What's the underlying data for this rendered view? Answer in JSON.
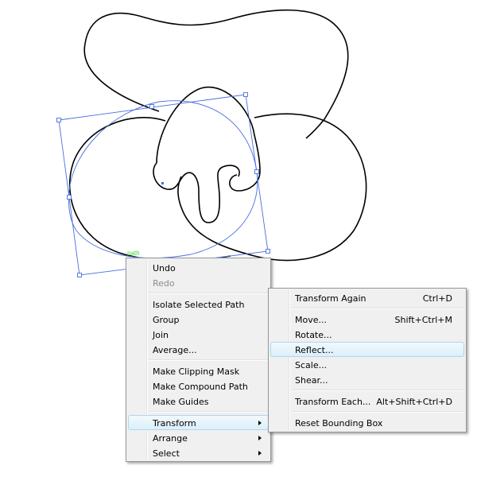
{
  "canvas": {
    "path_hint": "path",
    "selection_color": "#4a6ee0",
    "stroke_color": "#000000",
    "hint_color": "#3ad63a"
  },
  "context_menu": {
    "items": [
      {
        "label": "Undo",
        "disabled": false
      },
      {
        "label": "Redo",
        "disabled": true
      },
      {
        "separator": true
      },
      {
        "label": "Isolate Selected Path"
      },
      {
        "label": "Group"
      },
      {
        "label": "Join"
      },
      {
        "label": "Average..."
      },
      {
        "separator": true
      },
      {
        "label": "Make Clipping Mask"
      },
      {
        "label": "Make Compound Path"
      },
      {
        "label": "Make Guides"
      },
      {
        "separator": true
      },
      {
        "label": "Transform",
        "submenu": true,
        "active": true
      },
      {
        "label": "Arrange",
        "submenu": true
      },
      {
        "label": "Select",
        "submenu": true
      }
    ]
  },
  "transform_submenu": {
    "items": [
      {
        "label": "Transform Again",
        "shortcut": "Ctrl+D"
      },
      {
        "separator": true
      },
      {
        "label": "Move...",
        "shortcut": "Shift+Ctrl+M"
      },
      {
        "label": "Rotate..."
      },
      {
        "label": "Reflect...",
        "active": true
      },
      {
        "label": "Scale..."
      },
      {
        "label": "Shear..."
      },
      {
        "separator": true
      },
      {
        "label": "Transform Each...",
        "shortcut": "Alt+Shift+Ctrl+D"
      },
      {
        "separator": true
      },
      {
        "label": "Reset Bounding Box"
      }
    ]
  }
}
